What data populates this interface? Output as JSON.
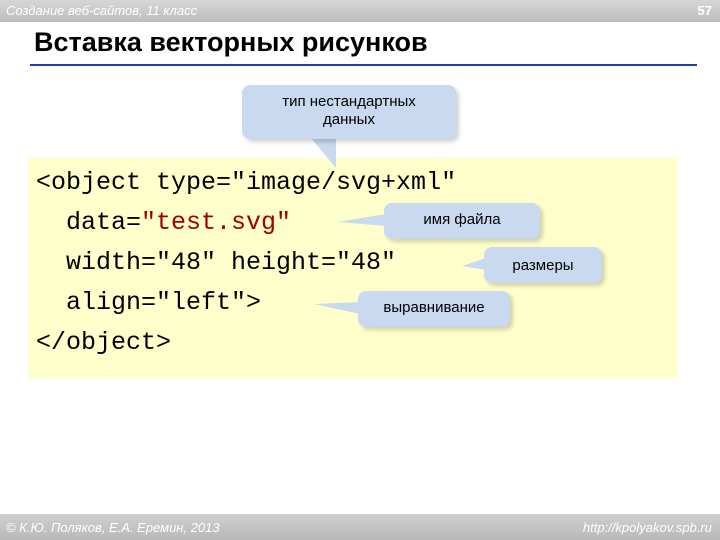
{
  "header": {
    "course": "Создание веб-сайтов, 11 класс",
    "page_number": "57"
  },
  "slide": {
    "title": "Вставка векторных рисунков"
  },
  "code": {
    "line1": "<object type=\"image/svg+xml\"",
    "line2_key": "  data=",
    "line2_value": "\"test.svg\"",
    "line3": "  width=\"48\" height=\"48\"",
    "line4": "  align=\"left\">",
    "line5": "</object>"
  },
  "callouts": {
    "type_line1": "тип нестандартных",
    "type_line2": "данных",
    "file": "имя файла",
    "size": "размеры",
    "align": "выравнивание"
  },
  "footer": {
    "copyright": "© К.Ю. Поляков, Е.А. Еремин, 2013",
    "url": "http://kpolyakov.spb.ru"
  },
  "colors": {
    "code_background": "#ffffcc",
    "callout": "#c8d9f0",
    "title_rule": "#1f3fa0",
    "string_value": "#a00000"
  }
}
